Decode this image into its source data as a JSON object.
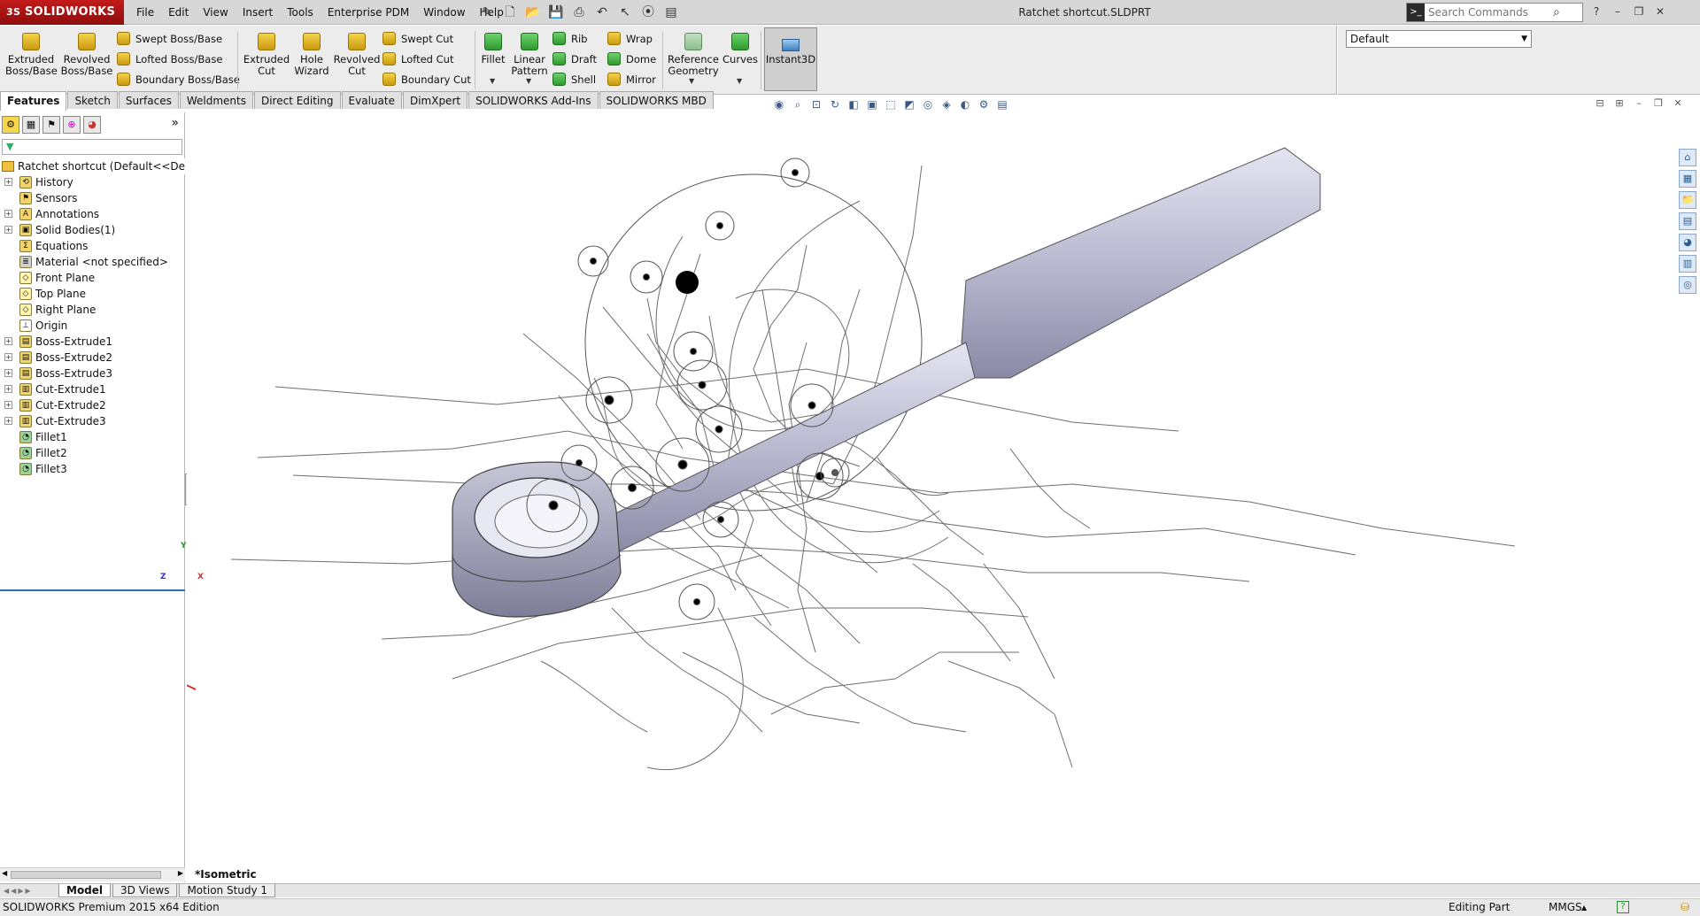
{
  "app": {
    "logo_text": "SOLIDWORKS",
    "logo_mark": "3S",
    "window_title": "Ratchet shortcut.SLDPRT",
    "menus": [
      "File",
      "Edit",
      "View",
      "Insert",
      "Tools",
      "Enterprise PDM",
      "Window",
      "Help"
    ],
    "search_placeholder": "Search Commands",
    "accent_color": "#c31b1b"
  },
  "ribbon": {
    "extruded_boss": "Extruded\nBoss/Base",
    "revolved_boss": "Revolved\nBoss/Base",
    "swept_boss": "Swept Boss/Base",
    "lofted_boss": "Lofted Boss/Base",
    "boundary_boss": "Boundary Boss/Base",
    "extruded_cut": "Extruded\nCut",
    "hole_wizard": "Hole\nWizard",
    "revolved_cut": "Revolved\nCut",
    "swept_cut": "Swept Cut",
    "lofted_cut": "Lofted Cut",
    "boundary_cut": "Boundary Cut",
    "fillet": "Fillet",
    "linear_pattern": "Linear\nPattern",
    "rib": "Rib",
    "draft": "Draft",
    "shell": "Shell",
    "wrap": "Wrap",
    "dome": "Dome",
    "mirror": "Mirror",
    "reference_geometry": "Reference\nGeometry",
    "curves": "Curves",
    "instant3d": "Instant3D"
  },
  "configuration": {
    "selected": "Default"
  },
  "tabs": [
    "Features",
    "Sketch",
    "Surfaces",
    "Weldments",
    "Direct Editing",
    "Evaluate",
    "DimXpert",
    "SOLIDWORKS Add-Ins",
    "SOLIDWORKS MBD"
  ],
  "feature_tree": {
    "root": "Ratchet shortcut  (Default<<Default",
    "items": [
      {
        "label": "History",
        "icon": "history-icon",
        "expand": true
      },
      {
        "label": "Sensors",
        "icon": "sensors-icon",
        "expand": false
      },
      {
        "label": "Annotations",
        "icon": "annotations-icon",
        "expand": true
      },
      {
        "label": "Solid Bodies(1)",
        "icon": "solid-bodies-icon",
        "expand": true
      },
      {
        "label": "Equations",
        "icon": "equations-icon",
        "expand": false
      },
      {
        "label": "Material <not specified>",
        "icon": "material-icon",
        "expand": false
      },
      {
        "label": "Front Plane",
        "icon": "plane-icon",
        "expand": false
      },
      {
        "label": "Top Plane",
        "icon": "plane-icon",
        "expand": false
      },
      {
        "label": "Right Plane",
        "icon": "plane-icon",
        "expand": false
      },
      {
        "label": "Origin",
        "icon": "origin-icon",
        "expand": false
      },
      {
        "label": "Boss-Extrude1",
        "icon": "boss-extrude-icon",
        "expand": true
      },
      {
        "label": "Boss-Extrude2",
        "icon": "boss-extrude-icon",
        "expand": true
      },
      {
        "label": "Boss-Extrude3",
        "icon": "boss-extrude-icon",
        "expand": true
      },
      {
        "label": "Cut-Extrude1",
        "icon": "cut-extrude-icon",
        "expand": true
      },
      {
        "label": "Cut-Extrude2",
        "icon": "cut-extrude-icon",
        "expand": true
      },
      {
        "label": "Cut-Extrude3",
        "icon": "cut-extrude-icon",
        "expand": true
      },
      {
        "label": "Fillet1",
        "icon": "fillet-icon",
        "expand": false
      },
      {
        "label": "Fillet2",
        "icon": "fillet-icon",
        "expand": false
      },
      {
        "label": "Fillet3",
        "icon": "fillet-icon",
        "expand": false
      }
    ]
  },
  "viewport": {
    "view_name": "*Isometric",
    "triad": {
      "x": "X",
      "y": "Y",
      "z": "Z"
    }
  },
  "bottom_tabs": [
    "Model",
    "3D Views",
    "Motion Study 1"
  ],
  "status": {
    "edition": "SOLIDWORKS Premium 2015 x64 Edition",
    "mode": "Editing Part",
    "units": "MMGS"
  }
}
